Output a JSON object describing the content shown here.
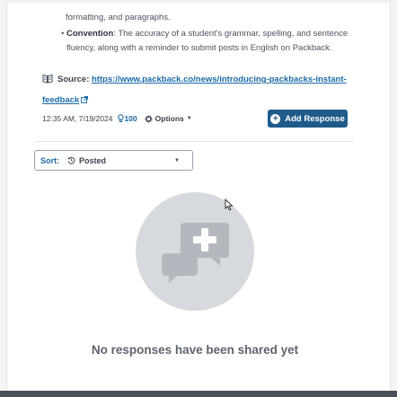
{
  "prev_item_tail": "formatting, and paragraphs.",
  "bullet": {
    "term": "Convention",
    "text": ": The accuracy of a student's grammar, spelling, and sentence fluency, along with a reminder to submit posts in English on Packback."
  },
  "source": {
    "label": "Source:",
    "link": "https://www.packback.co/news/introducing-packbacks-instant-feedback"
  },
  "meta": {
    "timestamp": "12:35 AM, 7/19/2024",
    "points": "100",
    "options_label": "Options"
  },
  "add_response_label": "Add Response",
  "sort": {
    "label": "Sort:",
    "value": "Posted"
  },
  "empty_state": {
    "message": "No responses have been shared yet",
    "icon": "chat-bubbles-plus-icon"
  },
  "colors": {
    "accent": "#1f5b8a",
    "link": "#1a6aa8",
    "empty_circle": "#d6d9dd"
  }
}
